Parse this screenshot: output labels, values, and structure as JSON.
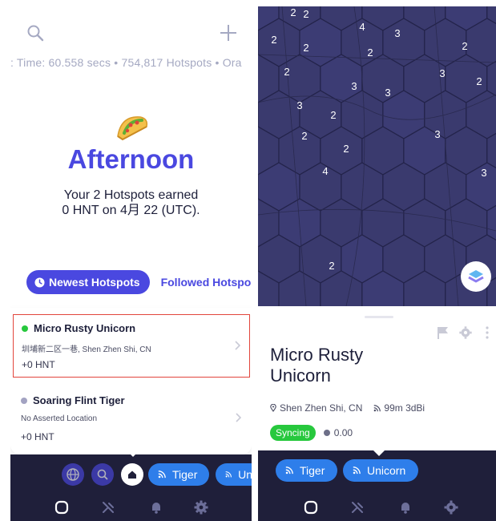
{
  "left": {
    "ticker": ": Time: 60.558 secs • 754,817 Hotspots • Ora",
    "greeting": "Afternoon",
    "earned_line1": "Your 2 Hotspots earned",
    "earned_line2": "0 HNT on 4月 22 (UTC).",
    "tabs": {
      "active": "Newest Hotspots",
      "inactive": "Followed Hotspo"
    },
    "hotspots": [
      {
        "name": "Micro Rusty Unicorn",
        "location": "圳埔新二区一巷, Shen Zhen Shi, CN",
        "reward": "+0 HNT",
        "status_color": "#27c83d"
      },
      {
        "name": "Soaring Flint Tiger",
        "location": "No Asserted Location",
        "reward": "+0 HNT",
        "status_color": "#a3a3c2"
      }
    ],
    "chips": [
      "Tiger",
      "Un"
    ],
    "icons": [
      "search-icon",
      "plus-icon",
      "taco-emoji",
      "clock-icon",
      "chevron-right-icon",
      "globe-icon",
      "home-icon",
      "helium-icon",
      "bell-icon",
      "gear-icon",
      "hotspot-icon",
      "transfer-icon"
    ]
  },
  "right": {
    "map_counts": [
      "2",
      "2",
      "2",
      "4",
      "3",
      "2",
      "2",
      "3",
      "2",
      "3",
      "3",
      "3",
      "2",
      "2",
      "3",
      "2",
      "4",
      "3",
      "2",
      "2",
      "2"
    ],
    "title_line1": "Micro Rusty",
    "title_line2": "Unicorn",
    "location": "Shen Zhen Shi, CN",
    "antenna": "99m 3dBi",
    "status": "Syncing",
    "balance": "0.00",
    "chips": [
      "Tiger",
      "Unicorn"
    ],
    "icons": [
      "layers-icon",
      "flag-icon",
      "gear-icon",
      "more-icon",
      "pin-icon",
      "antenna-icon"
    ]
  },
  "colors": {
    "accent": "#4a48e0",
    "chip": "#2e7eea",
    "bar": "#1f1f3a",
    "map": "#343468",
    "sync": "#27c83d",
    "selected_border": "#e2453c"
  }
}
